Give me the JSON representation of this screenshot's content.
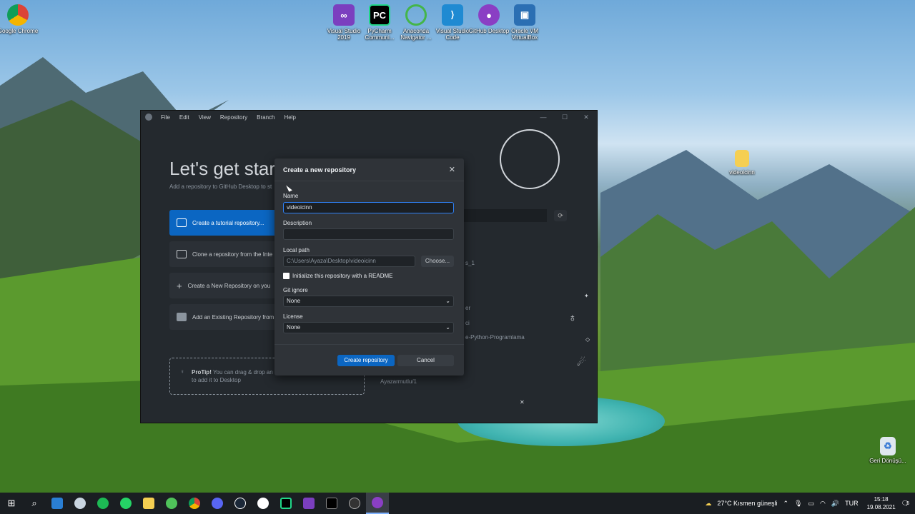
{
  "desktop_icons": [
    {
      "label": "Google Chrome"
    },
    {
      "label": "Visual Studio 2019"
    },
    {
      "label": "PyCharm Communi..."
    },
    {
      "label": "Anaconda Navigator ..."
    },
    {
      "label": "Visual Studio Code"
    },
    {
      "label": "GitHub Desktop"
    },
    {
      "label": "Oracle VM VirtualBox"
    },
    {
      "label": "videoicinn"
    },
    {
      "label": "Geri Dönüşü..."
    }
  ],
  "app": {
    "menu": [
      "File",
      "Edit",
      "View",
      "Repository",
      "Branch",
      "Help"
    ],
    "welcome_title": "Let's get star",
    "welcome_sub": "Add a repository to GitHub Desktop to st",
    "options": [
      "Create a tutorial repository...",
      "Clone a repository from the Inte",
      "Create a New Repository on you",
      "Add an Existing Repository from"
    ],
    "protip_bold": "ProTip!",
    "protip_text": "You can drag & drop an",
    "protip_text2": "to add it to Desktop",
    "repo_items": [
      "s_1",
      "er",
      "ci",
      "e-Python-Programlama",
      "Ayazarmutlu/1"
    ]
  },
  "modal": {
    "title": "Create a new repository",
    "name_label": "Name",
    "name_value": "videoicinn",
    "description_label": "Description",
    "description_value": "",
    "local_path_label": "Local path",
    "local_path_value": "C:\\Users\\Ayaza\\Desktop\\videoicinn",
    "choose_label": "Choose...",
    "readme_label": "Initialize this repository with a README",
    "gitignore_label": "Git ignore",
    "gitignore_value": "None",
    "license_label": "License",
    "license_value": "None",
    "create_label": "Create repository",
    "cancel_label": "Cancel"
  },
  "taskbar": {
    "weather": "27°C  Kısmen güneşli",
    "lang": "TUR",
    "time": "15:18",
    "date": "19.08.2021",
    "notif_count": "5"
  }
}
